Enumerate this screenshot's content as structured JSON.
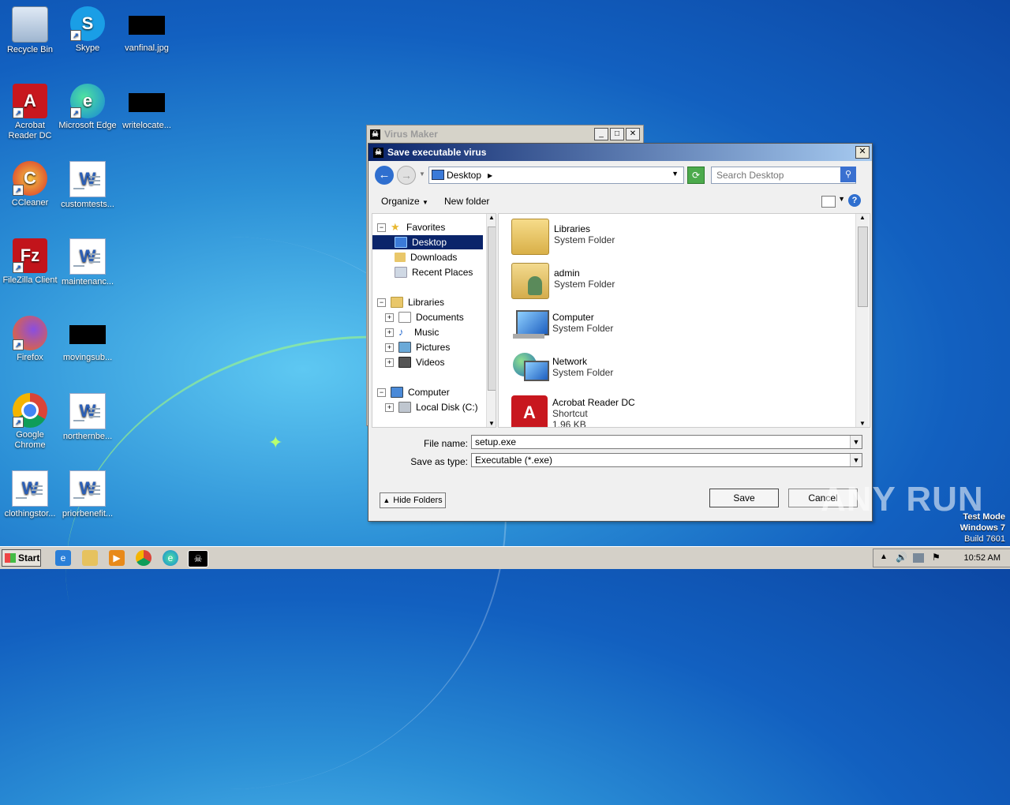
{
  "desktop": {
    "icons": [
      {
        "label": "Recycle Bin"
      },
      {
        "label": "Skype"
      },
      {
        "label": "vanfinal.jpg"
      },
      {
        "label": "Acrobat Reader DC"
      },
      {
        "label": "Microsoft Edge"
      },
      {
        "label": "writelocate..."
      },
      {
        "label": "CCleaner"
      },
      {
        "label": "customtests..."
      },
      {
        "label": "FileZilla Client"
      },
      {
        "label": "maintenanc..."
      },
      {
        "label": "Firefox"
      },
      {
        "label": "movingsub..."
      },
      {
        "label": "Google Chrome"
      },
      {
        "label": "northernbe..."
      },
      {
        "label": "clothingstor..."
      },
      {
        "label": "priorbenefit..."
      }
    ]
  },
  "virus_maker": {
    "title": "Virus Maker"
  },
  "dialog": {
    "title": "Save executable virus",
    "address": "Desktop",
    "search_placeholder": "Search Desktop",
    "toolbar": {
      "organize": "Organize",
      "new_folder": "New folder"
    },
    "tree": {
      "favorites": "Favorites",
      "desktop": "Desktop",
      "downloads": "Downloads",
      "recent": "Recent Places",
      "libraries": "Libraries",
      "documents": "Documents",
      "music": "Music",
      "pictures": "Pictures",
      "videos": "Videos",
      "computer": "Computer",
      "local_disk": "Local Disk (C:)"
    },
    "files": [
      {
        "name": "Libraries",
        "type": "System Folder"
      },
      {
        "name": "admin",
        "type": "System Folder"
      },
      {
        "name": "Computer",
        "type": "System Folder"
      },
      {
        "name": "Network",
        "type": "System Folder"
      },
      {
        "name": "Acrobat Reader DC",
        "type": "Shortcut",
        "size": "1.96 KB"
      }
    ],
    "file_name_label": "File name:",
    "file_name_value": "setup.exe",
    "save_type_label": "Save as type:",
    "save_type_value": "Executable (*.exe)",
    "hide_folders": "Hide Folders",
    "save": "Save",
    "cancel": "Cancel"
  },
  "watermark": "ANY RUN",
  "os_info": {
    "line1": "Test Mode",
    "line2": "Windows 7",
    "line3": "Build 7601"
  },
  "taskbar": {
    "start": "Start",
    "clock": "10:52 AM"
  }
}
